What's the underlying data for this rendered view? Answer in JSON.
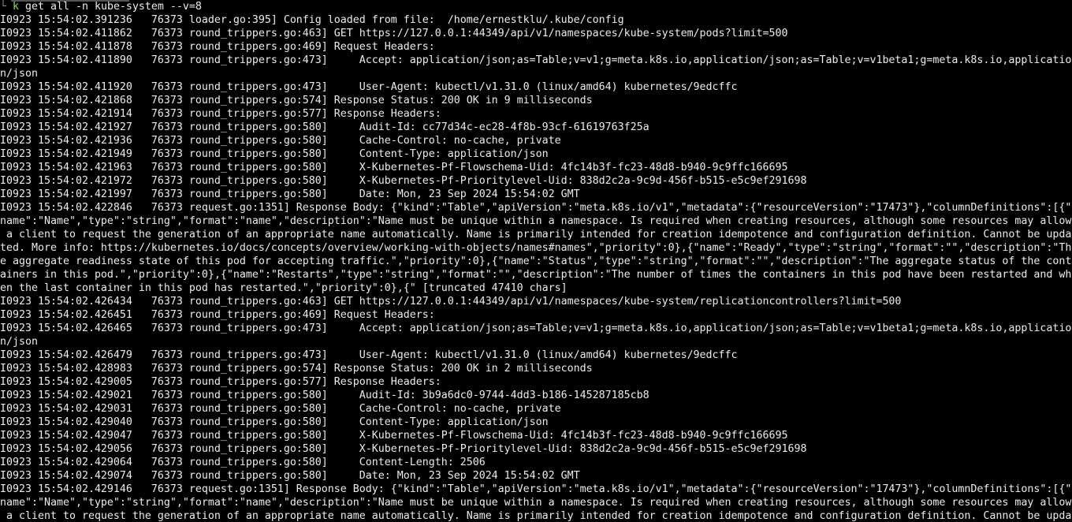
{
  "prompt": {
    "corner": "└ ",
    "alias": "k",
    "args": " get all -n kube-system --v=8",
    "alias_color": "#7ee04a"
  },
  "colors": {
    "background": "#000000",
    "foreground": "#ececec"
  },
  "output_rows": [
    "I0923 15:54:02.391236   76373 loader.go:395] Config loaded from file:  /home/ernestklu/.kube/config",
    "I0923 15:54:02.411862   76373 round_trippers.go:463] GET https://127.0.0.1:44349/api/v1/namespaces/kube-system/pods?limit=500",
    "I0923 15:54:02.411878   76373 round_trippers.go:469] Request Headers:",
    "I0923 15:54:02.411890   76373 round_trippers.go:473]     Accept: application/json;as=Table;v=v1;g=meta.k8s.io,application/json;as=Table;v=v1beta1;g=meta.k8s.io,applicatio",
    "n/json",
    "I0923 15:54:02.411920   76373 round_trippers.go:473]     User-Agent: kubectl/v1.31.0 (linux/amd64) kubernetes/9edcffc",
    "I0923 15:54:02.421868   76373 round_trippers.go:574] Response Status: 200 OK in 9 milliseconds",
    "I0923 15:54:02.421914   76373 round_trippers.go:577] Response Headers:",
    "I0923 15:54:02.421927   76373 round_trippers.go:580]     Audit-Id: cc77d34c-ec28-4f8b-93cf-61619763f25a",
    "I0923 15:54:02.421936   76373 round_trippers.go:580]     Cache-Control: no-cache, private",
    "I0923 15:54:02.421949   76373 round_trippers.go:580]     Content-Type: application/json",
    "I0923 15:54:02.421963   76373 round_trippers.go:580]     X-Kubernetes-Pf-Flowschema-Uid: 4fc14b3f-fc23-48d8-b940-9c9ffc166695",
    "I0923 15:54:02.421972   76373 round_trippers.go:580]     X-Kubernetes-Pf-Prioritylevel-Uid: 838d2c2a-9c9d-456f-b515-e5c9ef291698",
    "I0923 15:54:02.421997   76373 round_trippers.go:580]     Date: Mon, 23 Sep 2024 15:54:02 GMT",
    "I0923 15:54:02.422846   76373 request.go:1351] Response Body: {\"kind\":\"Table\",\"apiVersion\":\"meta.k8s.io/v1\",\"metadata\":{\"resourceVersion\":\"17473\"},\"columnDefinitions\":[{\"",
    "name\":\"Name\",\"type\":\"string\",\"format\":\"name\",\"description\":\"Name must be unique within a namespace. Is required when creating resources, although some resources may allow",
    " a client to request the generation of an appropriate name automatically. Name is primarily intended for creation idempotence and configuration definition. Cannot be upda",
    "ted. More info: https://kubernetes.io/docs/concepts/overview/working-with-objects/names#names\",\"priority\":0},{\"name\":\"Ready\",\"type\":\"string\",\"format\":\"\",\"description\":\"Th",
    "e aggregate readiness state of this pod for accepting traffic.\",\"priority\":0},{\"name\":\"Status\",\"type\":\"string\",\"format\":\"\",\"description\":\"The aggregate status of the cont",
    "ainers in this pod.\",\"priority\":0},{\"name\":\"Restarts\",\"type\":\"string\",\"format\":\"\",\"description\":\"The number of times the containers in this pod have been restarted and wh",
    "en the last container in this pod has restarted.\",\"priority\":0},{\" [truncated 47410 chars]",
    "I0923 15:54:02.426434   76373 round_trippers.go:463] GET https://127.0.0.1:44349/api/v1/namespaces/kube-system/replicationcontrollers?limit=500",
    "I0923 15:54:02.426451   76373 round_trippers.go:469] Request Headers:",
    "I0923 15:54:02.426465   76373 round_trippers.go:473]     Accept: application/json;as=Table;v=v1;g=meta.k8s.io,application/json;as=Table;v=v1beta1;g=meta.k8s.io,applicatio",
    "n/json",
    "I0923 15:54:02.426479   76373 round_trippers.go:473]     User-Agent: kubectl/v1.31.0 (linux/amd64) kubernetes/9edcffc",
    "I0923 15:54:02.428983   76373 round_trippers.go:574] Response Status: 200 OK in 2 milliseconds",
    "I0923 15:54:02.429005   76373 round_trippers.go:577] Response Headers:",
    "I0923 15:54:02.429021   76373 round_trippers.go:580]     Audit-Id: 3b9a6dc0-9744-4dd3-b186-145287185cb8",
    "I0923 15:54:02.429031   76373 round_trippers.go:580]     Cache-Control: no-cache, private",
    "I0923 15:54:02.429040   76373 round_trippers.go:580]     Content-Type: application/json",
    "I0923 15:54:02.429047   76373 round_trippers.go:580]     X-Kubernetes-Pf-Flowschema-Uid: 4fc14b3f-fc23-48d8-b940-9c9ffc166695",
    "I0923 15:54:02.429056   76373 round_trippers.go:580]     X-Kubernetes-Pf-Prioritylevel-Uid: 838d2c2a-9c9d-456f-b515-e5c9ef291698",
    "I0923 15:54:02.429064   76373 round_trippers.go:580]     Content-Length: 2506",
    "I0923 15:54:02.429074   76373 round_trippers.go:580]     Date: Mon, 23 Sep 2024 15:54:02 GMT",
    "I0923 15:54:02.429146   76373 request.go:1351] Response Body: {\"kind\":\"Table\",\"apiVersion\":\"meta.k8s.io/v1\",\"metadata\":{\"resourceVersion\":\"17473\"},\"columnDefinitions\":[{\"",
    "name\":\"Name\",\"type\":\"string\",\"format\":\"name\",\"description\":\"Name must be unique within a namespace. Is required when creating resources, although some resources may allow",
    " a client to request the generation of an appropriate name automatically. Name is primarily intended for creation idempotence and configuration definition. Cannot be upda"
  ]
}
